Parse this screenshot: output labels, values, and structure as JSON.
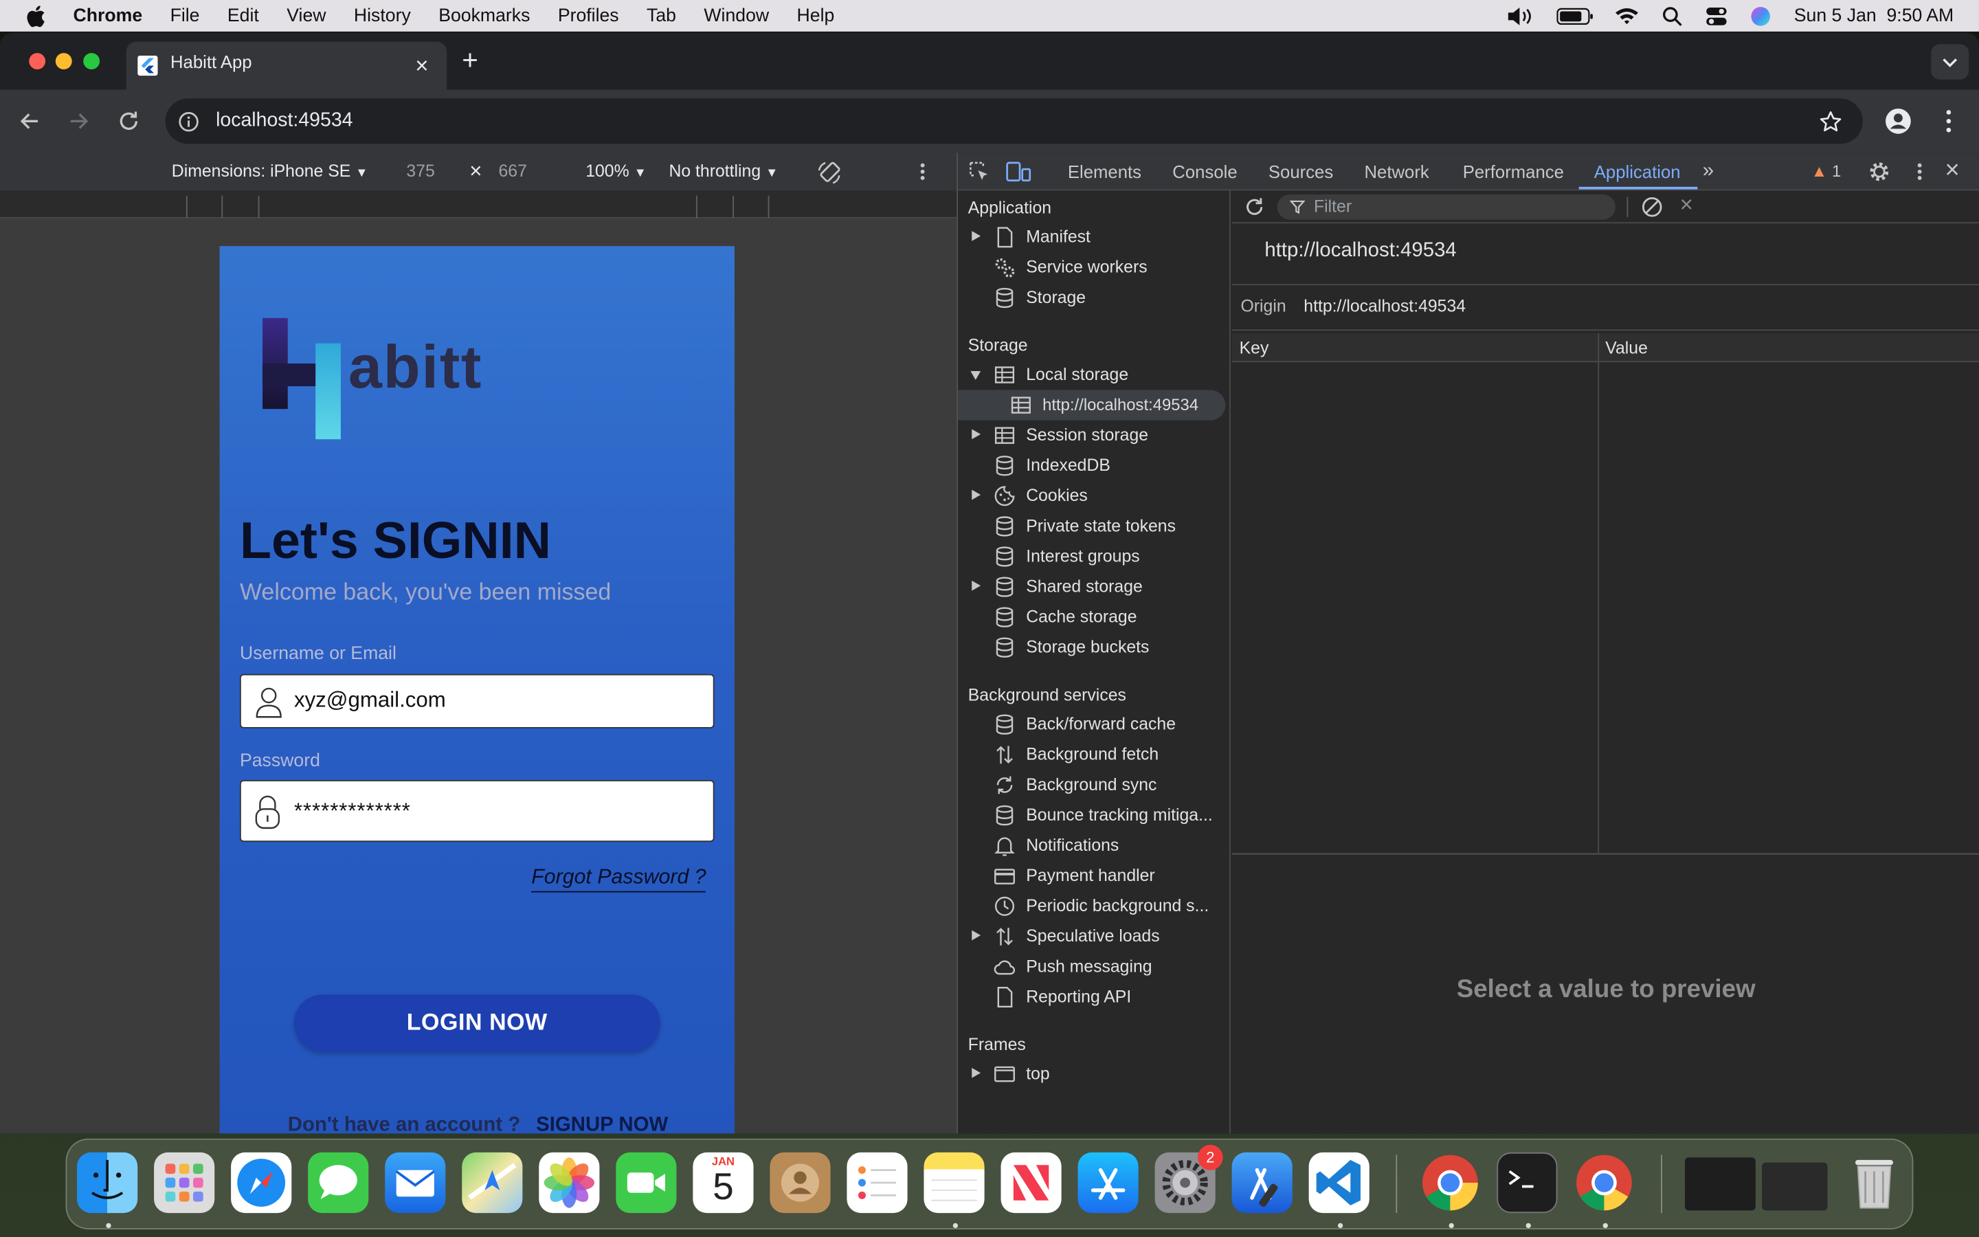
{
  "menubar": {
    "app": "Chrome",
    "items": [
      "File",
      "Edit",
      "View",
      "History",
      "Bookmarks",
      "Profiles",
      "Tab",
      "Window",
      "Help"
    ],
    "datetime": "Sun 5 Jan  9:50 AM"
  },
  "browser": {
    "tab_title": "Habitt App",
    "url": "localhost:49534"
  },
  "device_toolbar": {
    "dimensions": "Dimensions: iPhone SE",
    "width": "375",
    "times": "×",
    "height": "667",
    "zoom": "100%",
    "throttling": "No throttling"
  },
  "app_page": {
    "logo_text": "abitt",
    "title": "Let's SIGNIN",
    "subtitle": "Welcome back, you've been missed",
    "username_label": "Username or Email",
    "username_value": "xyz@gmail.com",
    "password_label": "Password",
    "password_value": "*************",
    "forgot": "Forgot Password ?",
    "login_button": "LOGIN NOW",
    "no_account": "Don't have an account ?",
    "signup": "SIGNUP NOW"
  },
  "devtools": {
    "tabs": [
      "Elements",
      "Console",
      "Sources",
      "Network",
      "Performance",
      "Application"
    ],
    "active_tab": "Application",
    "warning_count": "1",
    "sidebar": {
      "application_header": "Application",
      "application_items": [
        "Manifest",
        "Service workers",
        "Storage"
      ],
      "storage_header": "Storage",
      "local_storage": "Local storage",
      "local_storage_child": "http://localhost:49534",
      "storage_items": [
        "Session storage",
        "IndexedDB",
        "Cookies",
        "Private state tokens",
        "Interest groups",
        "Shared storage",
        "Cache storage",
        "Storage buckets"
      ],
      "background_header": "Background services",
      "background_items": [
        "Back/forward cache",
        "Background fetch",
        "Background sync",
        "Bounce tracking mitiga...",
        "Notifications",
        "Payment handler",
        "Periodic background s...",
        "Speculative loads",
        "Push messaging",
        "Reporting API"
      ],
      "frames_header": "Frames",
      "frames_items": [
        "top"
      ]
    },
    "main": {
      "filter_placeholder": "Filter",
      "origin_title": "http://localhost:49534",
      "origin_label": "Origin",
      "origin_value": "http://localhost:49534",
      "col_key": "Key",
      "col_value": "Value",
      "preview_text": "Select a value to preview"
    }
  },
  "dock": {
    "calendar_month": "JAN",
    "calendar_day": "5",
    "settings_badge": "2"
  },
  "colors": {
    "accent_blue": "#7cacf8",
    "app_gradient_top": "#3575d0",
    "login_button": "#1e3fb0"
  }
}
